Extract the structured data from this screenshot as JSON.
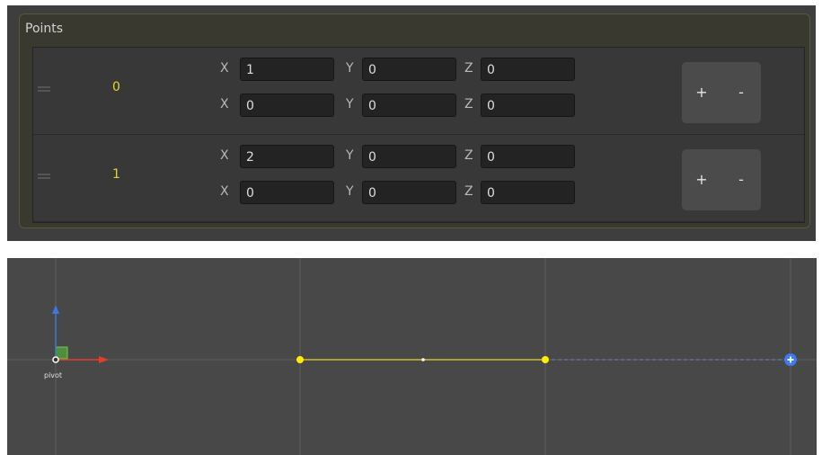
{
  "inspector": {
    "group_title": "Points",
    "rows": [
      {
        "index": "0",
        "vectors": [
          {
            "x_label": "X",
            "x": "1",
            "y_label": "Y",
            "y": "0",
            "z_label": "Z",
            "z": "0"
          },
          {
            "x_label": "X",
            "x": "0",
            "y_label": "Y",
            "y": "0",
            "z_label": "Z",
            "z": "0"
          }
        ],
        "add_label": "+",
        "remove_label": "-"
      },
      {
        "index": "1",
        "vectors": [
          {
            "x_label": "X",
            "x": "2",
            "y_label": "Y",
            "y": "0",
            "z_label": "Z",
            "z": "0"
          },
          {
            "x_label": "X",
            "x": "0",
            "y_label": "Y",
            "y": "0",
            "z_label": "Z",
            "z": "0"
          }
        ],
        "add_label": "+",
        "remove_label": "-"
      }
    ]
  },
  "scene": {
    "pivot_label": "pivot",
    "colors": {
      "background": "#484848",
      "grid": "#5e5e5e",
      "path": "#e6d52e",
      "point": "#ffee00",
      "axis_x": "#e0402a",
      "axis_y": "#3a78e6",
      "plane": "#4f8f3a",
      "add_handle": "#3d7be6",
      "preview_line": "#6b82c8"
    },
    "icons": [
      "axis-x-arrow-icon",
      "axis-y-arrow-icon",
      "plane-handle-icon",
      "add-point-icon"
    ]
  }
}
